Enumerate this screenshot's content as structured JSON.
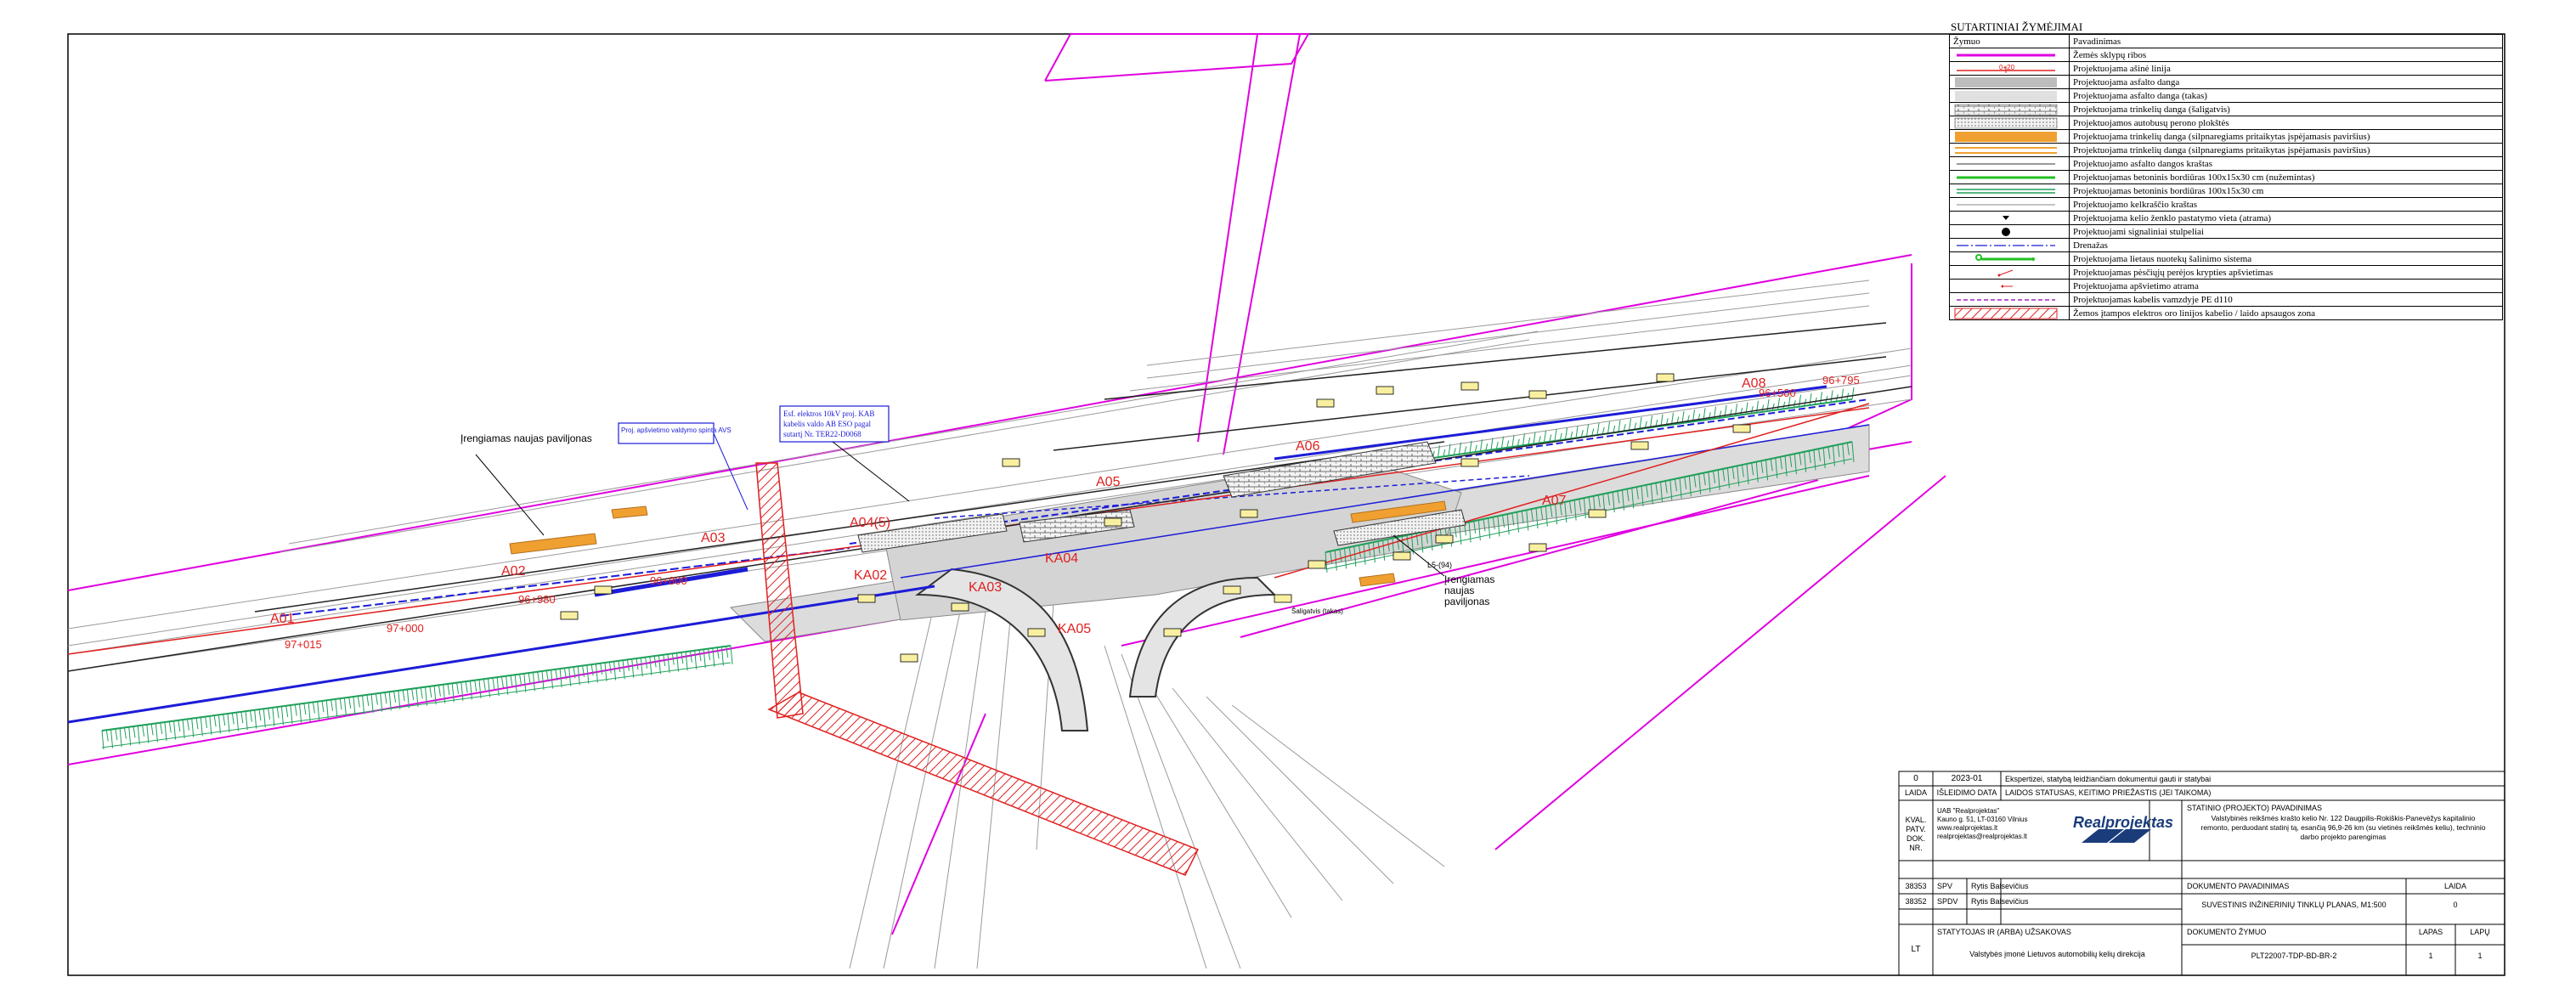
{
  "legend": {
    "title": "SUTARTINIAI ŽYMĖJIMAI",
    "col_symbol": "Žymuo",
    "col_name": "Pavadinimas",
    "items": [
      {
        "label": "Žemės sklypų ribos",
        "symbol": "magenta-line"
      },
      {
        "label": "Projektuojama ašinė linija",
        "symbol": "axis-line",
        "symbol_text": "0+20"
      },
      {
        "label": "Projektuojama asfalto danga",
        "symbol": "grey-fill"
      },
      {
        "label": "Projektuojama asfalto danga (takas)",
        "symbol": "light-grey-fill"
      },
      {
        "label": "Projektuojama trinkelių danga (šaligatvis)",
        "symbol": "brick-fill"
      },
      {
        "label": "Projektuojamos autobusų perono plokštės",
        "symbol": "dot-fill"
      },
      {
        "label": "Projektuojama trinkelių danga (silpnaregiams pritaikytas įspėjamasis paviršius)",
        "symbol": "orange-fill"
      },
      {
        "label": "Projektuojama trinkelių danga (silpnaregiams pritaikytas įspėjamasis paviršius)",
        "symbol": "orange-lines"
      },
      {
        "label": "Projektuojamo asfalto dangos kraštas",
        "symbol": "thin-line"
      },
      {
        "label": "Projektuojamas betoninis bordiūras 100x15x30 cm (nužemintas)",
        "symbol": "green-line"
      },
      {
        "label": "Projektuojamas betoninis bordiūras 100x15x30 cm",
        "symbol": "double-line"
      },
      {
        "label": "Projektuojamo kelkraščio kraštas",
        "symbol": "grey-line"
      },
      {
        "label": "Projektuojama kelio ženklo pastatymo vieta (atrama)",
        "symbol": "sign-post"
      },
      {
        "label": "Projektuojami signaliniai stulpeliai",
        "symbol": "black-dot"
      },
      {
        "label": "Drenažas",
        "symbol": "drain-line"
      },
      {
        "label": "Projektuojama lietaus nuotekų šalinimo sistema",
        "symbol": "storm-line"
      },
      {
        "label": "Projektuojamas pėsčiųjų perėjos krypties apšvietimas",
        "symbol": "lamp-arrow"
      },
      {
        "label": "Projektuojama apšvietimo atrama",
        "symbol": "lamp-post"
      },
      {
        "label": "Projektuojamas kabelis vamzdyje PE d110",
        "symbol": "cable-line"
      },
      {
        "label": "Žemos įtampos elektros oro linijos kabelio / laido apsaugos zona",
        "symbol": "red-hatch"
      }
    ]
  },
  "plan_labels": {
    "pavilion_left": "Įrengiamas naujas paviljonas",
    "pavilion_right": "Įrengiamas naujas paviljonas",
    "lighting_note": "Proj. apšvietimo valdymo spinta AVS",
    "cable_note_1": "Esf. elektros 10kV proj. KAB",
    "cable_note_2": "kabelis valdo AB ESO pagal",
    "cable_note_3": "sutartį Nr. TER22-D0068",
    "stop_a01": "A01",
    "stop_a02": "A02",
    "stop_a03": "A03",
    "stop_a04": "A04(5)",
    "stop_a05": "A05",
    "stop_a06": "A06",
    "stop_a07": "A07",
    "stop_a08": "A08",
    "stop_ka02": "KA02",
    "stop_ka03": "KA03",
    "stop_ka04": "KA04",
    "stop_ka05": "KA05",
    "ch_97_015": "97+015",
    "ch_97_000": "97+000",
    "ch_96_980": "96+980",
    "ch_96_800": "96+800",
    "ch_96_795": "96+795",
    "ch_96_500": "96+500",
    "small_note_1": "Šaligatvis (takas)",
    "small_note_2": "L5-(94)"
  },
  "title_block": {
    "rev_no": "0",
    "rev_date": "2023-01",
    "rev_desc": "Ekspertizei, statybą leidžiančiam dokumentui gauti ir statybai",
    "h_laida": "LAIDA",
    "h_isleidimo": "IŠLEIDIMO DATA",
    "h_status": "LAIDOS STATUSAS, KEITIMO PRIEŽASTIS (JEI TAIKOMA)",
    "kval_label": "KVAL. PATV. DOK. NR.",
    "company_name": "UAB \"Realprojektas\"",
    "company_addr": "Kauno g. 51, LT-03160 Vilnius",
    "company_web": "www.realprojektas.lt",
    "company_mail": "realprojektas@realprojektas.lt",
    "logo_text": "Realprojektas",
    "h_object": "STATINIO (PROJEKTO) PAVADINIMAS",
    "object_line1": "Valstybinės reikšmės krašto kelio Nr. 122 Daugpilis-Rokiškis-Panevėžys kapitalinio",
    "object_line2": "remonto, perduodant statinį tą, esančią 96,9-26 km (su vietinės reikšmės keliu), techninio",
    "object_line3": "darbo projekto parengimas",
    "p1_no": "38353",
    "p1_role": "SPV",
    "p1_name": "Rytis Balsevičius",
    "p2_no": "38352",
    "p2_role": "SPDV",
    "p2_name": "Rytis Balsevičius",
    "h_doc_name": "DOKUMENTO PAVADINIMAS",
    "doc_name": "SUVESTINIS INŽINERINIŲ TINKLŲ PLANAS, M1:500",
    "h_laida2": "LAIDA",
    "laida2": "0",
    "country": "LT",
    "h_owner": "STATYTOJAS IR (ARBA) UŽSAKOVAS",
    "owner": "Valstybės įmonė Lietuvos automobilių kelių direkcija",
    "h_doc_code": "DOKUMENTO ŽYMUO",
    "doc_code": "PLT22007-TDP-BD-BR-2",
    "h_lapas": "LAPAS",
    "lapas": "1",
    "h_lapu": "LAPŲ",
    "lapu": "1"
  },
  "colors": {
    "magenta": "#e000e0",
    "blue": "#1c1cd8",
    "green": "#1ea05a",
    "red": "#e02020",
    "orange": "#f0a030",
    "grey_fill": "#d8d8d8"
  }
}
